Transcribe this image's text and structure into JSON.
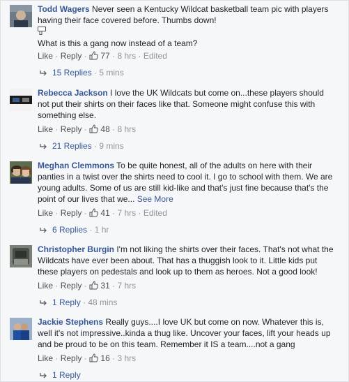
{
  "comments": [
    {
      "author": "Todd Wagers",
      "text": "Never seen a Kentucky Wildcat basketball team pic with players having their face covered before. Thumbs down!",
      "text2": "What is this a gang now instead of a team?",
      "like": "Like",
      "reply": "Reply",
      "likes": "77",
      "time": "8 hrs",
      "edited": "Edited",
      "replies_label": "15 Replies",
      "replies_time": "5 mins",
      "avatar_icon": "avatar-photo"
    },
    {
      "author": "Rebecca Jackson",
      "text": "I love the UK Wildcats but come on...these players should not put their shirts on their faces like that. Someone might confuse this with something else.",
      "like": "Like",
      "reply": "Reply",
      "likes": "48",
      "time": "8 hrs",
      "replies_label": "21 Replies",
      "replies_time": "9 mins",
      "avatar_icon": "avatar-photo"
    },
    {
      "author": "Meghan Clemmons",
      "text": "To be quite honest, all of the adults on here with their panties in a twist over the shirts need to cool it. I go to school with them. We are young adults. Some of us are still kid-like and that's just fine because that's the point of our lives that we...",
      "see_more": "See More",
      "like": "Like",
      "reply": "Reply",
      "likes": "41",
      "time": "7 hrs",
      "edited": "Edited",
      "replies_label": "6 Replies",
      "replies_time": "1 hr",
      "avatar_icon": "avatar-photo"
    },
    {
      "author": "Christopher Burgin",
      "text": "I'm not liking the shirts over their faces. That's not what the Wildcats have ever been about. That has a thuggish look to it. Little kids put these players on pedestals and look up to them as heroes. Not a good look!",
      "like": "Like",
      "reply": "Reply",
      "likes": "31",
      "time": "7 hrs",
      "replies_label": "1 Reply",
      "replies_time": "48 mins",
      "avatar_icon": "avatar-photo"
    },
    {
      "author": "Jackie Stephens",
      "text": "Really guys....I love UK but come on now. Whatever this is, well it's not impressive..kinda a thug like. Uncover your faces, lift your heads up and be proud to be on this team. Remember it IS a team....not a gang",
      "like": "Like",
      "reply": "Reply",
      "likes": "16",
      "time": "3 hrs",
      "replies_label": "1 Reply",
      "avatar_icon": "avatar-photo"
    }
  ],
  "colors": {
    "link": "#365899",
    "text": "#1d2129",
    "muted": "#90949c",
    "background": "#f6f7f9"
  }
}
